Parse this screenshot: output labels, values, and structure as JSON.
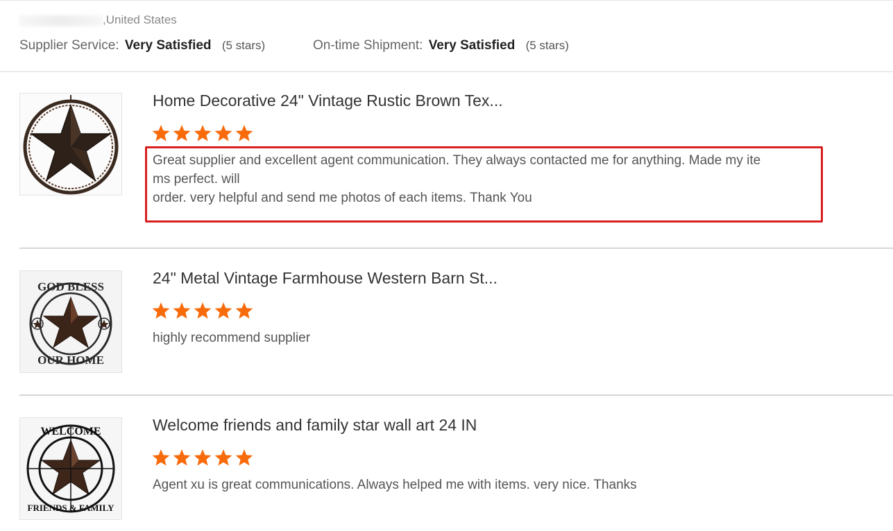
{
  "header": {
    "location_suffix": ",United States",
    "supplier_service_label": "Supplier Service:",
    "supplier_service_value": "Very Satisfied",
    "supplier_service_stars": "(5 stars)",
    "shipment_label": "On-time Shipment:",
    "shipment_value": "Very Satisfied",
    "shipment_stars": "(5 stars)"
  },
  "colors": {
    "star": "#f86b0b",
    "highlight": "#d81e1e"
  },
  "reviews": [
    {
      "title": "Home Decorative 24\" Vintage Rustic Brown Tex...",
      "rating": 5,
      "comment_lines": [
        "Great supplier and excellent agent communication.  They always contacted me for anything.  Made my ite",
        "ms perfect.  will",
        "order.  very helpful and send me photos of each items.  Thank You"
      ],
      "image": "rustic-star-wall-decor"
    },
    {
      "title": "24\" Metal Vintage Farmhouse Western Barn St...",
      "rating": 5,
      "comment_lines": [
        "highly recommend supplier"
      ],
      "image": "god-bless-our-home-star"
    },
    {
      "title": "Welcome friends and family star wall art 24 IN",
      "rating": 5,
      "comment_lines": [
        "Agent xu is great communications.  Always helped me with items.  very nice.   Thanks"
      ],
      "image": "welcome-friends-family-star"
    }
  ]
}
